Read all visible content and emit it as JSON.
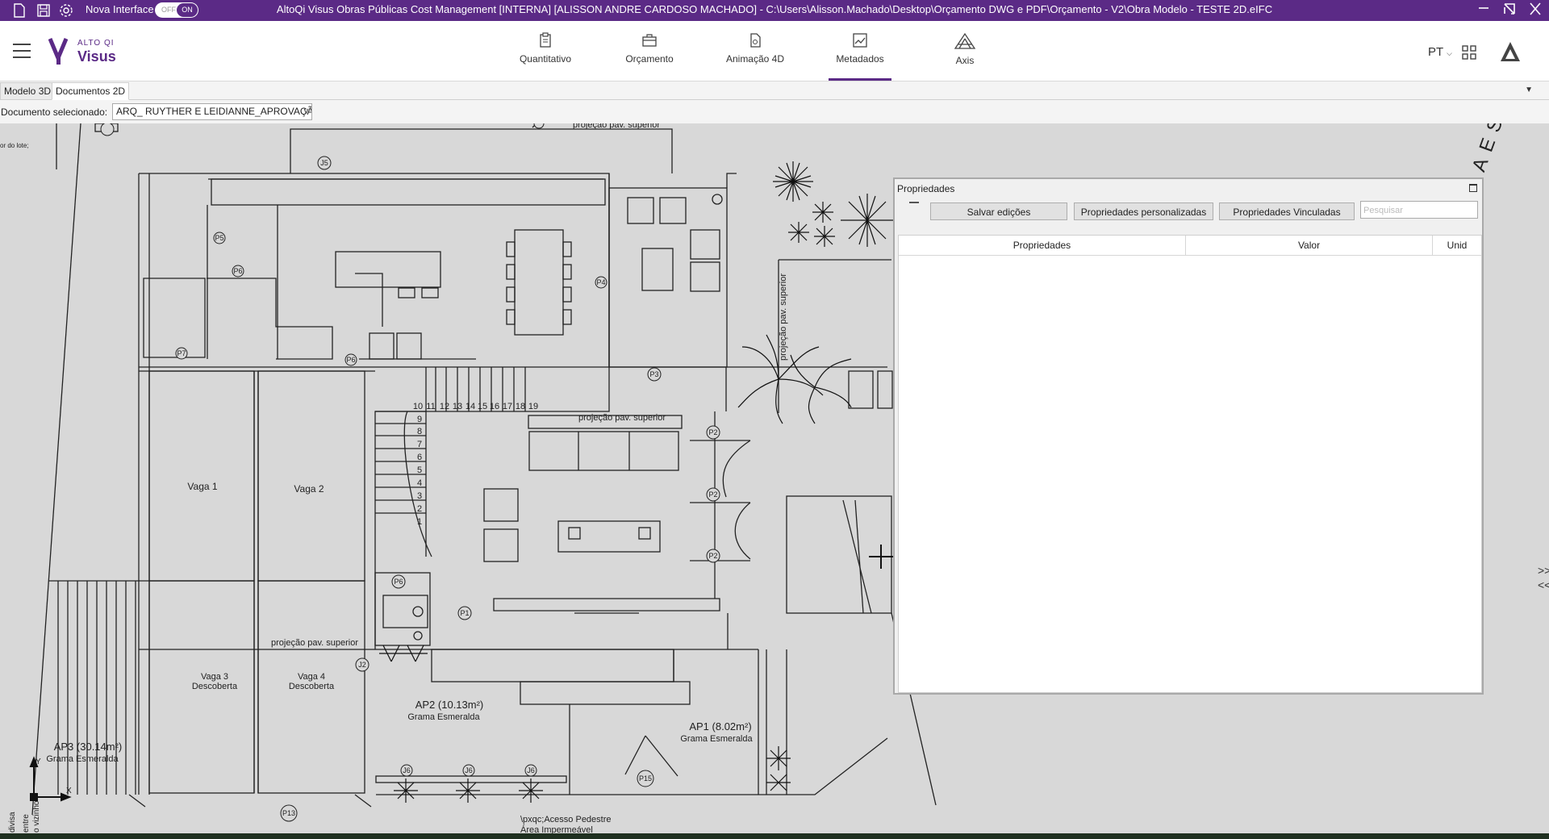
{
  "titlebar": {
    "nova_interface": "Nova Interface",
    "toggle_off": "OFF",
    "toggle_on": "ON",
    "window_title": "AltoQi Visus Obras Públicas Cost Management [INTERNA] [ALISSON ANDRE CARDOSO MACHADO] - C:\\Users\\Alisson.Machado\\Desktop\\Orçamento DWG e PDF\\Orçamento - V2\\Obra Modelo - TESTE 2D.eIFC"
  },
  "header": {
    "logo_small": "ALTO QI",
    "logo_big": "Visus",
    "nav": [
      {
        "label": "Quantitativo"
      },
      {
        "label": "Orçamento"
      },
      {
        "label": "Animação 4D"
      },
      {
        "label": "Metadados"
      },
      {
        "label": "Axis"
      }
    ],
    "lang": "PT"
  },
  "tabs": {
    "model3d": "Modelo 3D",
    "docs2d": "Documentos 2D"
  },
  "doc": {
    "label": "Documento selecionado:",
    "selected": "ARQ_ RUYTHER E LEIDIANNE_APROVAÇÃO"
  },
  "plan": {
    "labels": {
      "projecao_top": "projeção pav. superior",
      "lote_note": "or do lote;",
      "vaga1": "Vaga 1",
      "vaga2": "Vaga 2",
      "vaga3a": "Vaga 3",
      "vaga3b": "Descoberta",
      "vaga4a": "Vaga 4",
      "vaga4b": "Descoberta",
      "projecao_mid": "projeção pav. superior",
      "projecao_bottom": "projeção pav. superior",
      "projecao_vert": "projeção pav. superior",
      "ap2_title": "AP2 (10.13m²)",
      "ap2_sub": "Grama Esmeralda",
      "ap3_title": "AP3 (30.14m²)",
      "ap3_sub": "Grama Esmeralda",
      "ap1_title": "AP1 (8.02m²)",
      "ap1_sub": "Grama Esmeralda",
      "acesso": "\\pxqc;Acesso Pedestre",
      "area": "Área Impermeável",
      "street": "RAES",
      "axis_y": "Y",
      "axis_x": "X",
      "divisa": "divisa",
      "entre": "entre",
      "vizinho": "o vizinho"
    },
    "stairs": [
      "10",
      "11",
      "12",
      "13",
      "14",
      "15",
      "16",
      "17",
      "18",
      "19"
    ],
    "stairs_vertical": [
      "9",
      "8",
      "7",
      "6",
      "5",
      "4",
      "3",
      "2",
      "1"
    ],
    "tags": {
      "p5": "P5",
      "p6a": "P6",
      "p7": "P7",
      "p6b": "P6",
      "p4": "P4",
      "p3": "P3",
      "p2a": "P2",
      "p2b": "P2",
      "p2c": "P2",
      "p6c": "P6",
      "p1": "P1",
      "j5": "J5",
      "j2": "J2",
      "j6a": "J6",
      "j6b": "J6",
      "j6c": "J6",
      "p15": "P15",
      "p13": "P13"
    }
  },
  "properties": {
    "title": "Propriedades",
    "save": "Salvar edições",
    "custom": "Propriedades personalizadas",
    "linked": "Propriedades Vinculadas",
    "search_placeholder": "Pesquisar",
    "col_prop": "Propriedades",
    "col_val": "Valor",
    "col_unit": "Unid"
  },
  "side_arrows": {
    "right": ">>",
    "left": "<<"
  },
  "colors": {
    "brand": "#5b2a86",
    "canvas": "#d8d8d8"
  }
}
